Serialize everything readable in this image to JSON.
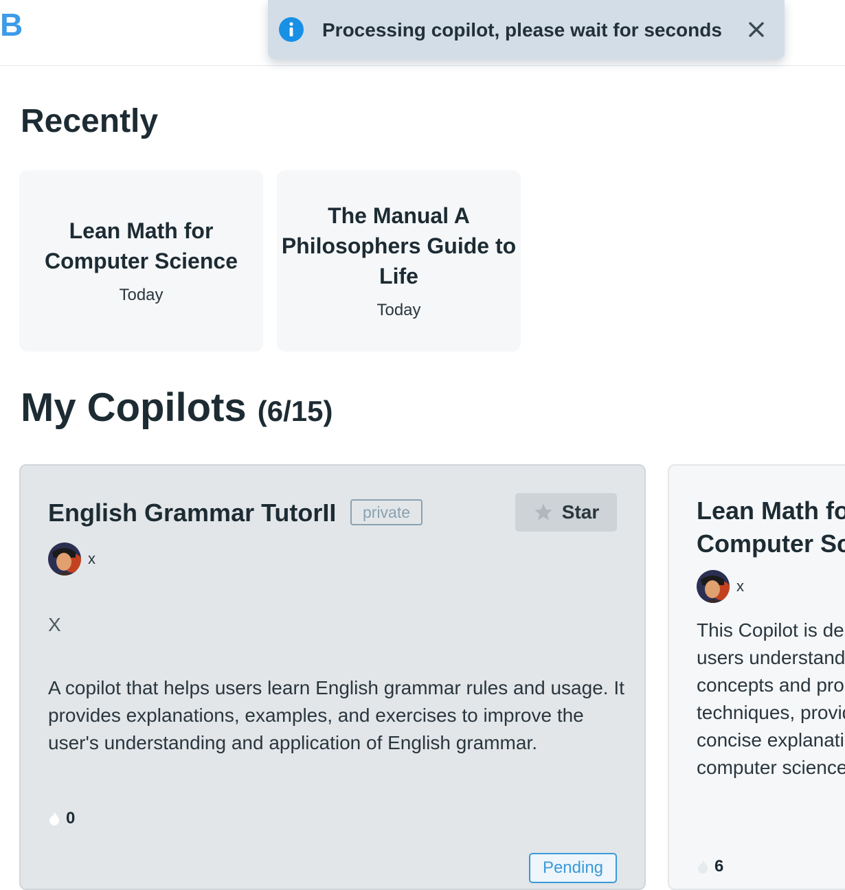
{
  "header": {
    "logo_text": "B"
  },
  "toast": {
    "message": "Processing copilot, please wait for seconds",
    "icon": "info-icon",
    "close_icon": "close-icon"
  },
  "recently": {
    "title": "Recently",
    "cards": [
      {
        "title": "Lean Math for Computer Science",
        "date": "Today"
      },
      {
        "title": "The Manual A Philosophers Guide to Life",
        "date": "Today"
      }
    ]
  },
  "my_copilots": {
    "title": "My Copilots",
    "count": "(6/15)",
    "cards": [
      {
        "title": "English Grammar TutorII",
        "visibility": "private",
        "star_label": "Star",
        "author": "x",
        "summary": "X",
        "description": "A copilot that helps users learn English grammar rules and usage. It provides explanations, examples, and exercises to improve the user's understanding and application of English grammar.",
        "count": "0",
        "status": "Pending"
      },
      {
        "title": "Lean Math for Computer Science",
        "author": "x",
        "description": "This Copilot is designed to help users understand mathematical concepts and problem-solving techniques, providing clear and concise explanations tailored to computer science.",
        "count": "6"
      }
    ]
  },
  "colors": {
    "accent": "#3d9be9",
    "toast_bg": "#d3dde8",
    "pending": "#3a9ad9"
  }
}
